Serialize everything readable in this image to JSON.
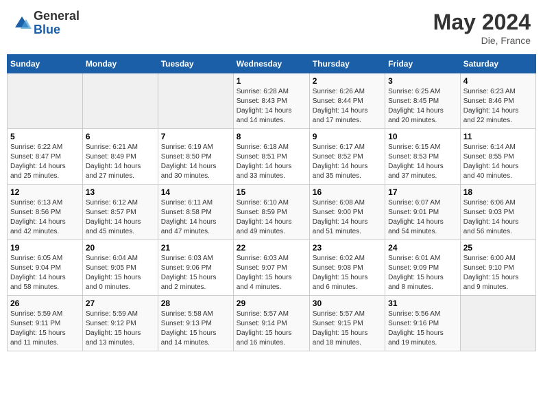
{
  "header": {
    "logo_line1": "General",
    "logo_line2": "Blue",
    "month_year": "May 2024",
    "location": "Die, France"
  },
  "weekdays": [
    "Sunday",
    "Monday",
    "Tuesday",
    "Wednesday",
    "Thursday",
    "Friday",
    "Saturday"
  ],
  "weeks": [
    [
      {
        "day": "",
        "info": ""
      },
      {
        "day": "",
        "info": ""
      },
      {
        "day": "",
        "info": ""
      },
      {
        "day": "1",
        "info": "Sunrise: 6:28 AM\nSunset: 8:43 PM\nDaylight: 14 hours\nand 14 minutes."
      },
      {
        "day": "2",
        "info": "Sunrise: 6:26 AM\nSunset: 8:44 PM\nDaylight: 14 hours\nand 17 minutes."
      },
      {
        "day": "3",
        "info": "Sunrise: 6:25 AM\nSunset: 8:45 PM\nDaylight: 14 hours\nand 20 minutes."
      },
      {
        "day": "4",
        "info": "Sunrise: 6:23 AM\nSunset: 8:46 PM\nDaylight: 14 hours\nand 22 minutes."
      }
    ],
    [
      {
        "day": "5",
        "info": "Sunrise: 6:22 AM\nSunset: 8:47 PM\nDaylight: 14 hours\nand 25 minutes."
      },
      {
        "day": "6",
        "info": "Sunrise: 6:21 AM\nSunset: 8:49 PM\nDaylight: 14 hours\nand 27 minutes."
      },
      {
        "day": "7",
        "info": "Sunrise: 6:19 AM\nSunset: 8:50 PM\nDaylight: 14 hours\nand 30 minutes."
      },
      {
        "day": "8",
        "info": "Sunrise: 6:18 AM\nSunset: 8:51 PM\nDaylight: 14 hours\nand 33 minutes."
      },
      {
        "day": "9",
        "info": "Sunrise: 6:17 AM\nSunset: 8:52 PM\nDaylight: 14 hours\nand 35 minutes."
      },
      {
        "day": "10",
        "info": "Sunrise: 6:15 AM\nSunset: 8:53 PM\nDaylight: 14 hours\nand 37 minutes."
      },
      {
        "day": "11",
        "info": "Sunrise: 6:14 AM\nSunset: 8:55 PM\nDaylight: 14 hours\nand 40 minutes."
      }
    ],
    [
      {
        "day": "12",
        "info": "Sunrise: 6:13 AM\nSunset: 8:56 PM\nDaylight: 14 hours\nand 42 minutes."
      },
      {
        "day": "13",
        "info": "Sunrise: 6:12 AM\nSunset: 8:57 PM\nDaylight: 14 hours\nand 45 minutes."
      },
      {
        "day": "14",
        "info": "Sunrise: 6:11 AM\nSunset: 8:58 PM\nDaylight: 14 hours\nand 47 minutes."
      },
      {
        "day": "15",
        "info": "Sunrise: 6:10 AM\nSunset: 8:59 PM\nDaylight: 14 hours\nand 49 minutes."
      },
      {
        "day": "16",
        "info": "Sunrise: 6:08 AM\nSunset: 9:00 PM\nDaylight: 14 hours\nand 51 minutes."
      },
      {
        "day": "17",
        "info": "Sunrise: 6:07 AM\nSunset: 9:01 PM\nDaylight: 14 hours\nand 54 minutes."
      },
      {
        "day": "18",
        "info": "Sunrise: 6:06 AM\nSunset: 9:03 PM\nDaylight: 14 hours\nand 56 minutes."
      }
    ],
    [
      {
        "day": "19",
        "info": "Sunrise: 6:05 AM\nSunset: 9:04 PM\nDaylight: 14 hours\nand 58 minutes."
      },
      {
        "day": "20",
        "info": "Sunrise: 6:04 AM\nSunset: 9:05 PM\nDaylight: 15 hours\nand 0 minutes."
      },
      {
        "day": "21",
        "info": "Sunrise: 6:03 AM\nSunset: 9:06 PM\nDaylight: 15 hours\nand 2 minutes."
      },
      {
        "day": "22",
        "info": "Sunrise: 6:03 AM\nSunset: 9:07 PM\nDaylight: 15 hours\nand 4 minutes."
      },
      {
        "day": "23",
        "info": "Sunrise: 6:02 AM\nSunset: 9:08 PM\nDaylight: 15 hours\nand 6 minutes."
      },
      {
        "day": "24",
        "info": "Sunrise: 6:01 AM\nSunset: 9:09 PM\nDaylight: 15 hours\nand 8 minutes."
      },
      {
        "day": "25",
        "info": "Sunrise: 6:00 AM\nSunset: 9:10 PM\nDaylight: 15 hours\nand 9 minutes."
      }
    ],
    [
      {
        "day": "26",
        "info": "Sunrise: 5:59 AM\nSunset: 9:11 PM\nDaylight: 15 hours\nand 11 minutes."
      },
      {
        "day": "27",
        "info": "Sunrise: 5:59 AM\nSunset: 9:12 PM\nDaylight: 15 hours\nand 13 minutes."
      },
      {
        "day": "28",
        "info": "Sunrise: 5:58 AM\nSunset: 9:13 PM\nDaylight: 15 hours\nand 14 minutes."
      },
      {
        "day": "29",
        "info": "Sunrise: 5:57 AM\nSunset: 9:14 PM\nDaylight: 15 hours\nand 16 minutes."
      },
      {
        "day": "30",
        "info": "Sunrise: 5:57 AM\nSunset: 9:15 PM\nDaylight: 15 hours\nand 18 minutes."
      },
      {
        "day": "31",
        "info": "Sunrise: 5:56 AM\nSunset: 9:16 PM\nDaylight: 15 hours\nand 19 minutes."
      },
      {
        "day": "",
        "info": ""
      }
    ]
  ]
}
